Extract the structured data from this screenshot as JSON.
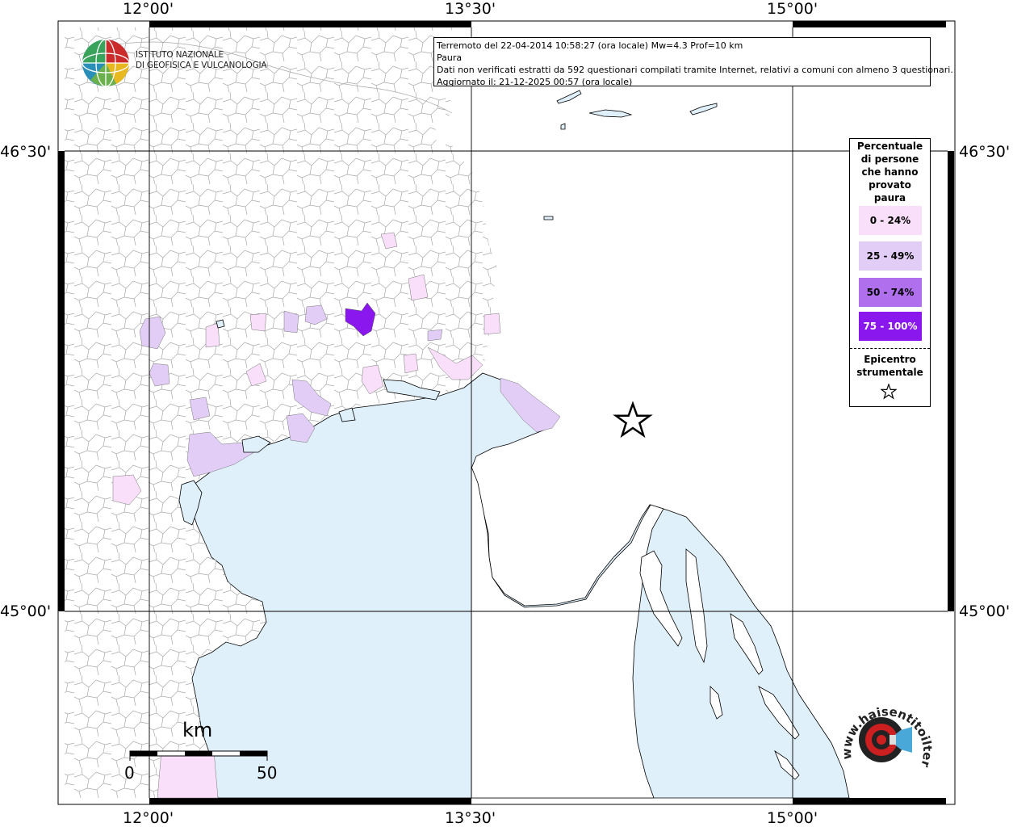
{
  "info": {
    "line1": "Terremoto del 22-04-2014 10:58:27 (ora locale) Mw=4.3 Prof=10 km",
    "line2": "Paura",
    "line3": "Dati non verificati estratti da 592 questionari compilati tramite Internet, relativi a comuni con almeno 3 questionari.",
    "line4": "Aggiornato il: 21-12-2025 00:57 (ora locale)"
  },
  "axes": {
    "lon_labels": [
      "12°00'",
      "13°30'",
      "15°00'"
    ],
    "lat_labels": [
      "46°30'",
      "45°00'"
    ]
  },
  "legend": {
    "title_lines": [
      "Percentuale",
      "di persone",
      "che hanno",
      "provato",
      "paura"
    ],
    "items": [
      {
        "label": "0 - 24%",
        "color": "#f9dff9"
      },
      {
        "label": "25 - 49%",
        "color": "#e2cdf6"
      },
      {
        "label": "50 - 74%",
        "color": "#b070ee"
      },
      {
        "label": "75 - 100%",
        "color": "#8a17ee"
      }
    ],
    "epicenter_lines": [
      "Epicentro",
      "strumentale"
    ]
  },
  "logo": {
    "line1": "ISTITUTO NAZIONALE",
    "line2": "DI GEOFISICA E VULCANOLOGIA"
  },
  "scale": {
    "unit": "km",
    "start": "0",
    "end": "50"
  },
  "hst_logo": {
    "text": "www.haisentitoilterremoto.it"
  },
  "colors": {
    "sea": "#dff0fb",
    "land": "#ffffff",
    "boundaries": "#9a9a9a",
    "grid": "#000000"
  }
}
